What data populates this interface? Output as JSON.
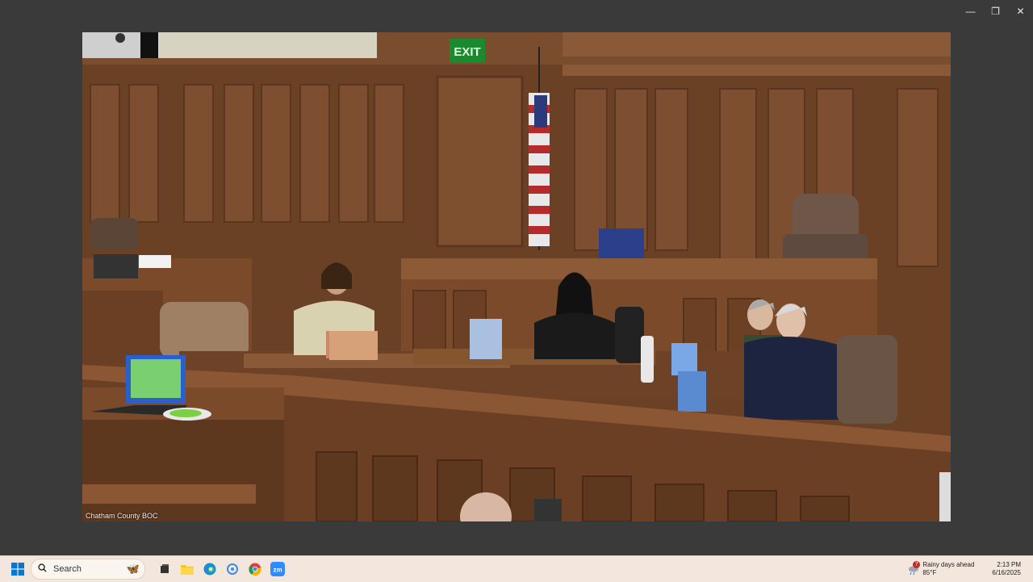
{
  "window": {
    "minimize": "—",
    "restore": "❐",
    "close": "✕"
  },
  "video": {
    "label": "Chatham County BOC",
    "exit_sign": "EXIT"
  },
  "taskbar": {
    "search_placeholder": "Search",
    "apps": [
      "windows-start",
      "search",
      "file-explorer",
      "edge",
      "snipping-tool",
      "chrome",
      "zoom"
    ]
  },
  "tray": {
    "weather_title": "Rainy days ahead",
    "weather_temp": "85°F",
    "weather_badge": "7",
    "time": "2:13 PM",
    "date": "6/16/2025"
  },
  "colors": {
    "wood": "#7a4a2a",
    "wood_dark": "#5a3620",
    "taskbar": "#f3e6dd",
    "exit_green": "#2ecc40"
  }
}
